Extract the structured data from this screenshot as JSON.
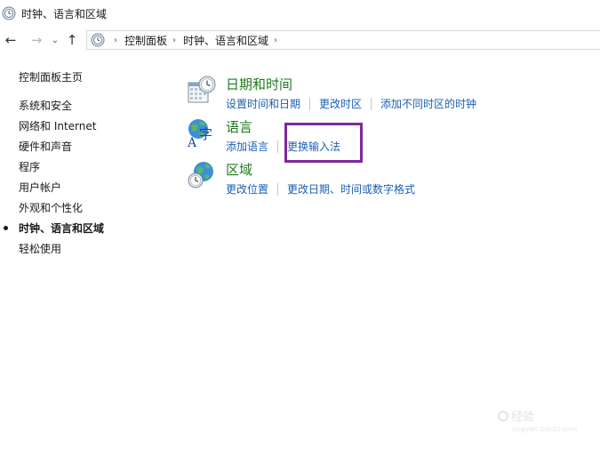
{
  "window": {
    "title": "时钟、语言和区域"
  },
  "nav": {
    "back_icon": "back-arrow-icon",
    "forward_icon": "forward-arrow-icon",
    "recent_icon": "chevron-down-icon",
    "up_icon": "up-arrow-icon",
    "breadcrumbs": [
      "控制面板",
      "时钟、语言和区域"
    ]
  },
  "sidebar": {
    "home": "控制面板主页",
    "items": [
      {
        "label": "系统和安全"
      },
      {
        "label": "网络和 Internet"
      },
      {
        "label": "硬件和声音"
      },
      {
        "label": "程序"
      },
      {
        "label": "用户帐户"
      },
      {
        "label": "外观和个性化"
      },
      {
        "label": "时钟、语言和区域"
      },
      {
        "label": "轻松使用"
      }
    ]
  },
  "categories": [
    {
      "title": "日期和时间",
      "icon": "calendar-clock-icon",
      "links": [
        "设置时间和日期",
        "更改时区",
        "添加不同时区的时钟"
      ]
    },
    {
      "title": "语言",
      "icon": "language-globe-icon",
      "links": [
        "添加语言",
        "更换输入法"
      ]
    },
    {
      "title": "区域",
      "icon": "region-globe-icon",
      "links": [
        "更改位置",
        "更改日期、时间或数字格式"
      ]
    }
  ],
  "colors": {
    "category_title": "#1e7a1e",
    "link": "#1a5fb4",
    "highlight_border": "#7b2a9e"
  },
  "watermark": {
    "text": "经验",
    "sub": "jingyan.baidu.com"
  }
}
